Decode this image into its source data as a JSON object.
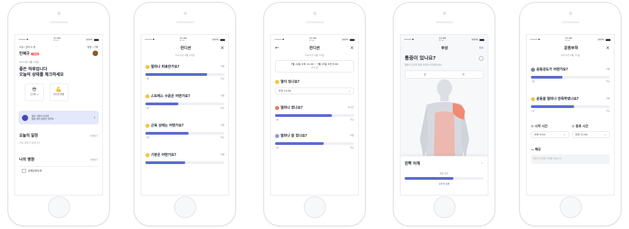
{
  "status_bar": {
    "carrier": "••••• ❤",
    "time": "21:00",
    "time_sub": "B.Lab····",
    "battery": "100%"
  },
  "home": {
    "greeting_top": "오늘 | 엄마 & 응",
    "name": "민혜규",
    "name_tag": "기록중",
    "top_right": "알림  |  기록",
    "date": "2021년 4월 22일",
    "hello_line1": "좋은 하루입니다",
    "hello_line2": "오늘의 상태를 체크하세요",
    "moods": [
      {
        "icon": "sunglasses-face",
        "label": "신나요 :)"
      },
      {
        "icon": "flex-arm",
        "label": "컨디션 좋음"
      }
    ],
    "banner": "생리 기록이 도우미\n일일 생리 일정이 있어요",
    "schedule_title": "오늘의 일정",
    "schedule_more": "전체보기",
    "schedule_empty": "오늘 일정이 없습니다",
    "hospital_title": "나의 병원",
    "hospital_more": "전체보기",
    "hospital_item": "은혜산부인과"
  },
  "condition": {
    "title": "컨디션",
    "date": "2021년 4월 22일",
    "close": "×",
    "questions": [
      {
        "emoji": "tired-face",
        "label": "얼마나 피로한가요?",
        "value": "3점",
        "level": 0.78,
        "low": "나쁨",
        "high": "좋음"
      },
      {
        "emoji": "stressed-face",
        "label": "스트레스 수준은 어떤가요?",
        "value": "3점",
        "level": 0.42,
        "low": "나쁨",
        "high": "좋음"
      },
      {
        "emoji": "muscle-arm",
        "label": "근육 상태는 어떤가요?",
        "value": "3점",
        "level": 0.55,
        "low": "나쁨",
        "high": "좋음"
      },
      {
        "emoji": "smile-face",
        "label": "기분은 어떤가요?",
        "value": "3점",
        "level": 0.5,
        "low": "나쁨",
        "high": "좋음"
      }
    ]
  },
  "condition2": {
    "title": "컨디션",
    "date": "2021년 4월 22일",
    "close": "×",
    "back": "←",
    "range_line1": "7월 24일 오후 11:00 ~ 7월 25일 오전 9:00",
    "range_line2": "10시간",
    "q_fever": "열이 있나요?",
    "fever_value": "오전 11:00",
    "q_sleep": "얼마나 잤나요?",
    "sleep_value": "8시간",
    "sleep_level": 0.72,
    "q_sleep_quality": "얼마나 잘 잤나요?",
    "sleep_quality_value": "4점",
    "sleep_quality_level": 0.62,
    "low": "나쁨",
    "high": "좋음"
  },
  "pain": {
    "title": "부상",
    "done": "완료",
    "question": "통증이 있나요?",
    "sub": "통증이 있다면 통증 부위를 터치해주세요",
    "seg": [
      "앞",
      "뒤"
    ],
    "sheet_title": "왼쪽 어깨",
    "sheet_caption": "통증 정도",
    "sheet_value": "심하게 높음"
  },
  "exercise": {
    "title": "운동부하",
    "date": "2021년 4월 22일",
    "close": "×",
    "q_intensity": "운동강도가 어떤가요?",
    "intensity_value": "3점",
    "intensity_level": 0.4,
    "q_satisfaction": "운동을 얼마나 만족하였나요?",
    "satisfaction_value": "3점",
    "satisfaction_level": 0.55,
    "low": "나쁨",
    "high": "좋음",
    "start_label": "시작 시간",
    "start_value": "오후 5:04",
    "end_label": "종료 시간",
    "end_value": "오전 11:04",
    "memo_label": "메모",
    "memo_placeholder": "운동과 관련된 기록을 하십시오."
  },
  "colors": {
    "accent": "#5b6bd1",
    "tag": "#ff5a5a",
    "pain": "#f08a76",
    "body": "#d6dae0"
  }
}
